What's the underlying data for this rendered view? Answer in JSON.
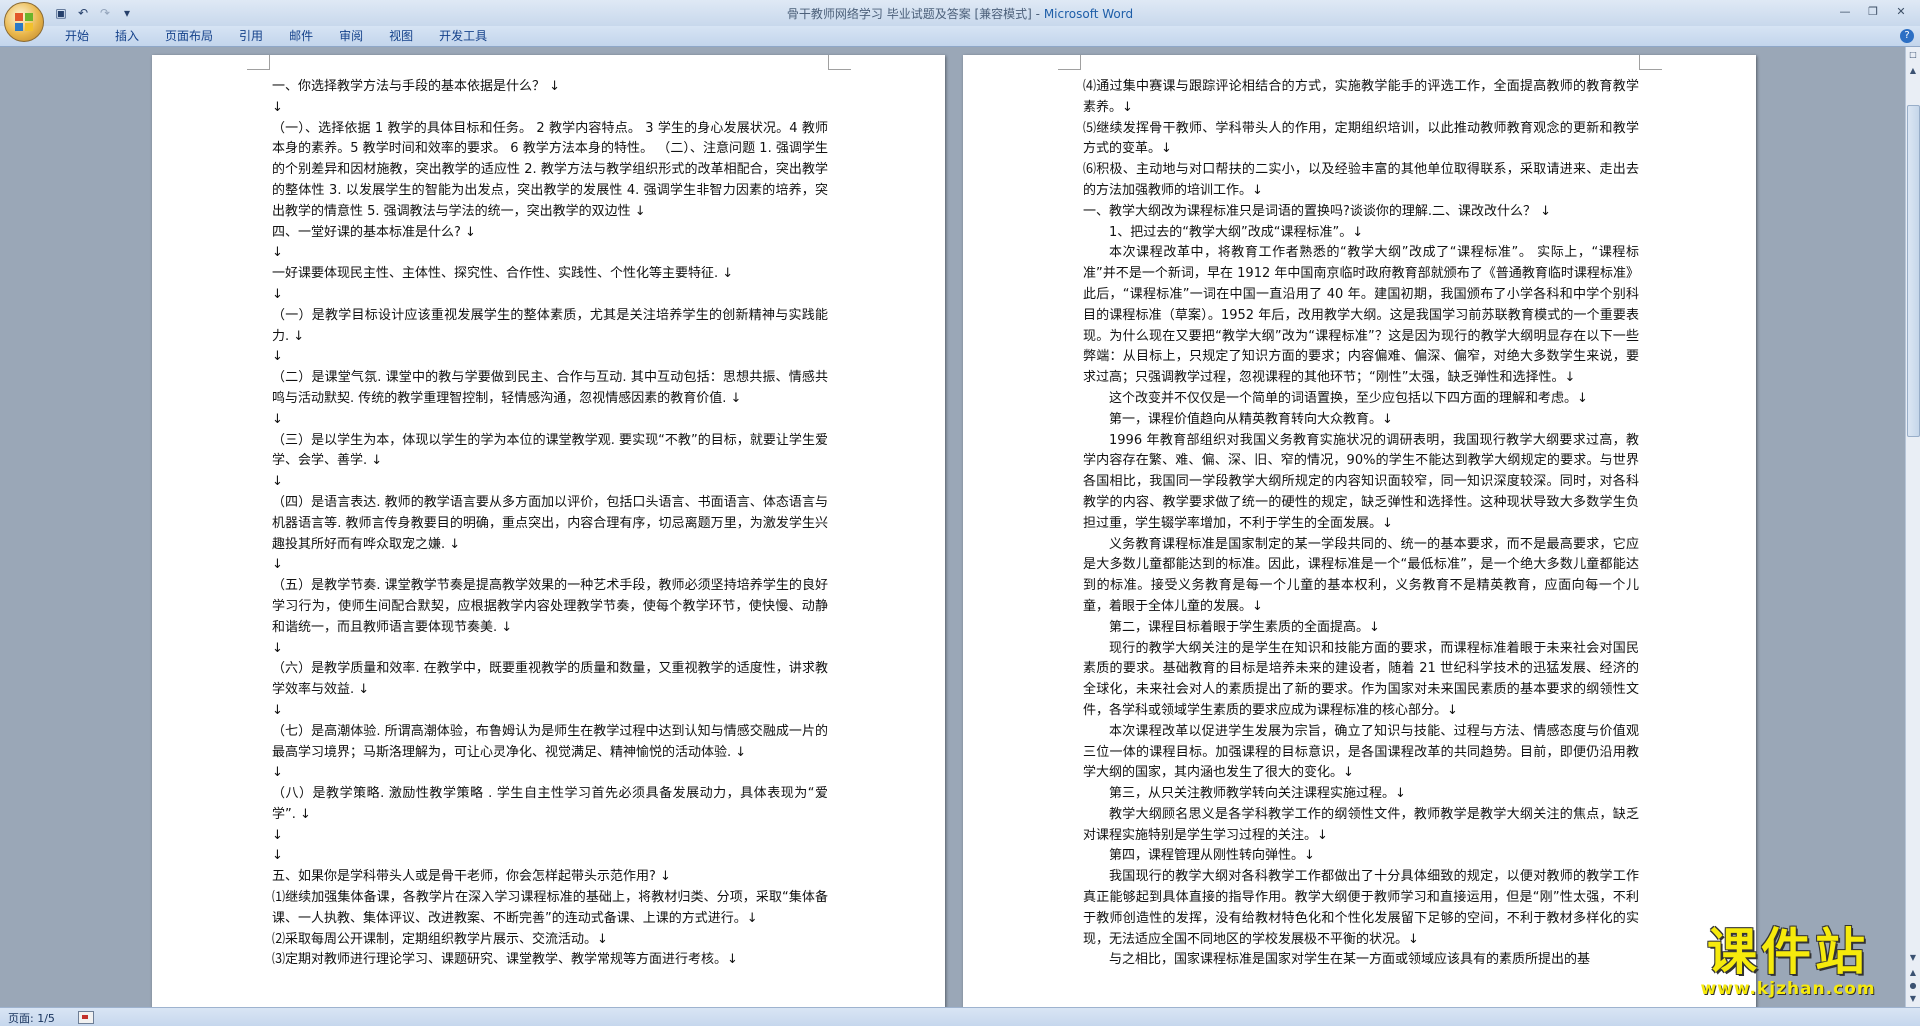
{
  "window": {
    "title_doc": "骨干教师网络学习 毕业试题及答案 [兼容模式] - ",
    "title_app": "Microsoft Word"
  },
  "quick_access": {
    "save_icon": "save-icon",
    "undo_icon": "undo-icon",
    "redo_icon": "redo-icon",
    "customize_icon": "customize-icon"
  },
  "ribbon": {
    "tabs": [
      "开始",
      "插入",
      "页面布局",
      "引用",
      "邮件",
      "审阅",
      "视图",
      "开发工具"
    ]
  },
  "left_page": {
    "paragraphs": [
      "一、你选择教学方法与手段的基本依据是什么？ ↓",
      "↓",
      "（一）、选择依据  1 教学的具体目标和任务。 2 教学内容特点。 3 学生的身心发展状况。4 教师本身的素养。5 教学时间和效率的要求。       6 教学方法本身的特性。       （二）、注意问题  1. 强调学生的个别差异和因材施教，突出教学的适应性 2. 教学方法与教学组织形式的改革相配合，突出教学的整体性      3. 以发展学生的智能为出发点，突出教学的发展性      4. 强调学生非智力因素的培养，突出教学的情意性      5. 强调教法与学法的统一，突出教学的双边性 ↓",
      "四、一堂好课的基本标准是什么? ↓",
      "↓",
      "一好课要体现民主性、主体性、探究性、合作性、实践性、个性化等主要特征. ↓",
      "↓",
      "（一）是教学目标设计应该重视发展学生的整体素质，尤其是关注培养学生的创新精神与实践能力. ↓",
      "↓",
      "（二）是课堂气氛. 课堂中的教与学要做到民主、合作与互动. 其中互动包括：思想共振、情感共鸣与活动默契. 传统的教学重理智控制，轻情感沟通，忽视情感因素的教育价值. ↓",
      "↓",
      "（三）是以学生为本，体现以学生的学为本位的课堂教学观. 要实现“不教”的目标，就要让学生爱学、会学、善学. ↓",
      "↓",
      "（四）是语言表达. 教师的教学语言要从多方面加以评价，包括口头语言、书面语言、体态语言与机器语言等. 教师言传身教要目的明确，重点突出，内容合理有序，切忌离题万里，为激发学生兴趣投其所好而有哗众取宠之嫌. ↓",
      "↓",
      "（五）是教学节奏. 课堂教学节奏是提高教学效果的一种艺术手段，教师必须坚持培养学生的良好学习行为，使师生间配合默契，应根据教学内容处理教学节奏，使每个教学环节，使快慢、动静和谐统一，而且教师语言要体现节奏美. ↓",
      "↓",
      "（六）是教学质量和效率. 在教学中，既要重视教学的质量和数量，又重视教学的适度性，讲求教学效率与效益. ↓",
      "↓",
      "（七）是高潮体验. 所谓高潮体验，布鲁姆认为是师生在教学过程中达到认知与情感交融成一片的最高学习境界；马斯洛理解为，可让心灵净化、视觉满足、精神愉悦的活动体验. ↓",
      "↓",
      "（八）是教学策略. 激励性教学策略  . 学生自主性学习首先必须具备发展动力，具体表现为“爱学”. ↓",
      "↓",
      "↓",
      "五、如果你是学科带头人或是骨干老师，你会怎样起带头示范作用? ↓",
      "⑴继续加强集体备课，各教学片在深入学习课程标准的基础上，将教材归类、分项，采取“集体备课、一人执教、集体评议、改进教案、不断完善”的连动式备课、上课的方式进行。↓",
      "⑵采取每周公开课制，定期组织教学片展示、交流活动。↓",
      "⑶定期对教师进行理论学习、课题研究、课堂教学、教学常规等方面进行考核。↓"
    ]
  },
  "right_page": {
    "paragraphs": [
      {
        "t": "⑷通过集中赛课与跟踪评论相结合的方式，实施教学能手的评选工作，全面提高教师的教育教学素养。↓",
        "i": false
      },
      {
        "t": "⑸继续发挥骨干教师、学科带头人的作用，定期组织培训，以此推动教师教育观念的更新和教学方式的变革。↓",
        "i": false
      },
      {
        "t": "⑹积极、主动地与对口帮扶的二实小，以及经验丰富的其他单位取得联系，采取请进来、走出去的方法加强教师的培训工作。↓",
        "i": false
      },
      {
        "t": "一、教学大纲改为课程标准只是词语的置换吗?谈谈你的理解.二、课改改什么？ ↓",
        "i": false
      },
      {
        "t": "1、把过去的“教学大纲”改成“课程标准”。↓",
        "i": true
      },
      {
        "t": "本次课程改革中，将教育工作者熟悉的“教学大纲”改成了“课程标准”。 实际上，“课程标准”并不是一个新词，早在 1912 年中国南京临时政府教育部就颁布了《普通教育临时课程标准》此后，“课程标准”一词在中国一直沿用了 40 年。建国初期，我国颁布了小学各科和中学个别科目的课程标准（草案）。1952 年后，改用教学大纲。这是我国学习前苏联教育模式的一个重要表现。为什么现在又要把“教学大纲”改为“课程标准”？这是因为现行的教学大纲明显存在以下一些弊端：从目标上，只规定了知识方面的要求；内容偏难、偏深、偏窄，对绝大多数学生来说，要求过高；只强调教学过程，忽视课程的其他环节；“刚性”太强，缺乏弹性和选择性。↓",
        "i": true
      },
      {
        "t": "这个改变并不仅仅是一个简单的词语置换，至少应包括以下四方面的理解和考虑。↓",
        "i": true
      },
      {
        "t": "第一，课程价值趋向从精英教育转向大众教育。↓",
        "i": true
      },
      {
        "t": "1996 年教育部组织对我国义务教育实施状况的调研表明，我国现行教学大纲要求过高，教学内容存在繁、难、偏、深、旧、窄的情况，90%的学生不能达到教学大纲规定的要求。与世界各国相比，我国同一学段教学大纲所规定的内容知识面较窄，同一知识深度较深。同时，对各科教学的内容、教学要求做了统一的硬性的规定，缺乏弹性和选择性。这种现状导致大多数学生负担过重，学生辍学率增加，不利于学生的全面发展。↓",
        "i": true
      },
      {
        "t": "义务教育课程标准是国家制定的某一学段共同的、统一的基本要求，而不是最高要求，它应是大多数儿童都能达到的标准。因此，课程标准是一个“最低标准”，是一个绝大多数儿童都能达到的标准。接受义务教育是每一个儿童的基本权利，义务教育不是精英教育，应面向每一个儿童，着眼于全体儿童的发展。↓",
        "i": true
      },
      {
        "t": "第二，课程目标着眼于学生素质的全面提高。↓",
        "i": true
      },
      {
        "t": "现行的教学大纲关注的是学生在知识和技能方面的要求，而课程标准着眼于未来社会对国民素质的要求。基础教育的目标是培养未来的建设者，随着 21 世纪科学技术的迅猛发展、经济的全球化，未来社会对人的素质提出了新的要求。作为国家对未来国民素质的基本要求的纲领性文件，各学科或领域学生素质的要求应成为课程标准的核心部分。↓",
        "i": true
      },
      {
        "t": "本次课程改革以促进学生发展为宗旨，确立了知识与技能、过程与方法、情感态度与价值观三位一体的课程目标。加强课程的目标意识，是各国课程改革的共同趋势。目前，即便仍沿用教学大纲的国家，其内涵也发生了很大的变化。↓",
        "i": true
      },
      {
        "t": "第三，从只关注教师教学转向关注课程实施过程。↓",
        "i": true
      },
      {
        "t": "教学大纲顾名思义是各学科教学工作的纲领性文件，教师教学是教学大纲关注的焦点，缺乏对课程实施特别是学生学习过程的关注。↓",
        "i": true
      },
      {
        "t": "第四，课程管理从刚性转向弹性。↓",
        "i": true
      },
      {
        "t": "我国现行的教学大纲对各科教学工作都做出了十分具体细致的规定，以便对教师的教学工作真正能够起到具体直接的指导作用。教学大纲便于教师学习和直接运用，但是“刚”性太强，不利于教师创造性的发挥，没有给教材特色化和个性化发展留下足够的空间，不利于教材多样化的实现，无法适应全国不同地区的学校发展极不平衡的状况。↓",
        "i": true
      },
      {
        "t": "与之相比，国家课程标准是国家对学生在某一方面或领域应该具有的素质所提出的基",
        "i": true
      }
    ]
  },
  "status": {
    "page_indicator": "页面: 1/5"
  },
  "watermark": {
    "main": "课件站",
    "url": "www.kjzhan.com"
  }
}
